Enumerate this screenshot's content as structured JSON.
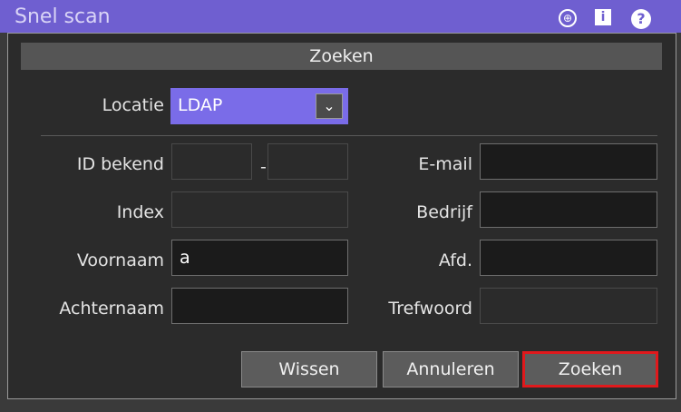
{
  "appbar": {
    "title": "Snel scan"
  },
  "dialog": {
    "title": "Zoeken",
    "location": {
      "label": "Locatie",
      "value": "LDAP"
    },
    "fields": {
      "id_label": "ID bekend",
      "id_separator": "-",
      "email_label": "E-mail",
      "index_label": "Index",
      "company_label": "Bedrijf",
      "firstname_label": "Voornaam",
      "firstname_value": "a",
      "department_label": "Afd.",
      "lastname_label": "Achternaam",
      "keyword_label": "Trefwoord"
    },
    "buttons": {
      "clear": "Wissen",
      "cancel": "Annuleren",
      "search": "Zoeken"
    }
  },
  "colors": {
    "accent": "#7a6ce8",
    "highlight": "#e0191c"
  }
}
